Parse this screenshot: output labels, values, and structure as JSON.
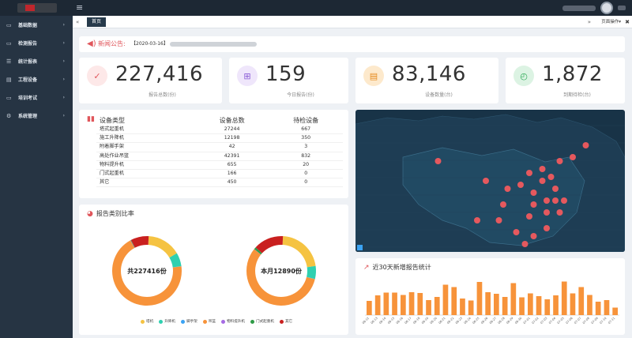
{
  "topbar": {
    "menu_icon": "hamburger-icon"
  },
  "sidebar": {
    "items": [
      {
        "label": "基础数据",
        "icon": "folder-icon"
      },
      {
        "label": "检测报告",
        "icon": "folder-icon"
      },
      {
        "label": "统计报表",
        "icon": "list-icon"
      },
      {
        "label": "工程设备",
        "icon": "server-icon"
      },
      {
        "label": "培训考试",
        "icon": "monitor-icon"
      },
      {
        "label": "系统管理",
        "icon": "gear-icon"
      }
    ]
  },
  "tabs": {
    "home": "首页",
    "page_ops": "页面操作",
    "prev_glyph": "«",
    "next_glyph": "»",
    "close_glyph": "✖"
  },
  "notice": {
    "label": "新闻公告:",
    "date_text": "【2020-03-16】"
  },
  "stats": [
    {
      "value": "227,416",
      "label": "报告总数(份)",
      "color": "#e0565b",
      "bg": "#fde8e8",
      "icon": "clipboard-icon",
      "glyph": "✓"
    },
    {
      "value": "159",
      "label": "今日报告(份)",
      "color": "#8a5cd6",
      "bg": "#efe6fb",
      "icon": "add-report-icon",
      "glyph": "⊞"
    },
    {
      "value": "83,146",
      "label": "设备数量(台)",
      "color": "#e58a1f",
      "bg": "#fde9cc",
      "icon": "barrier-icon",
      "glyph": "▤"
    },
    {
      "value": "1,872",
      "label": "到期待检(台)",
      "color": "#2eaa57",
      "bg": "#dcf3e3",
      "icon": "timer-icon",
      "glyph": "◴"
    }
  ],
  "device_panel": {
    "title": "设备类型",
    "col_total": "设备总数",
    "col_pending": "待检设备",
    "rows": [
      {
        "type": "塔式起重机",
        "total": "27244",
        "pending": "667"
      },
      {
        "type": "施工升降机",
        "total": "12198",
        "pending": "350"
      },
      {
        "type": "附着脚手架",
        "total": "42",
        "pending": "3"
      },
      {
        "type": "高处作业吊篮",
        "total": "42391",
        "pending": "832"
      },
      {
        "type": "物料提升机",
        "total": "655",
        "pending": "20"
      },
      {
        "type": "门式起重机",
        "total": "166",
        "pending": "0"
      },
      {
        "type": "其它",
        "total": "450",
        "pending": "0"
      }
    ]
  },
  "ratio_panel": {
    "title": "报告类别比率",
    "donut_left_label": "共227416份",
    "donut_right_label": "本月12890份",
    "legend": [
      {
        "name": "塔机",
        "color": "#f5c342"
      },
      {
        "name": "升降机",
        "color": "#2fd0b0"
      },
      {
        "name": "脚手架",
        "color": "#3ba3f3"
      },
      {
        "name": "吊篮",
        "color": "#f7933a"
      },
      {
        "name": "物料提升机",
        "color": "#a66be3"
      },
      {
        "name": "门式起重机",
        "color": "#2f9b47"
      },
      {
        "name": "其它",
        "color": "#c9201f"
      }
    ],
    "donut_left": [
      0.15,
      0.06,
      0.001,
      0.66,
      0.001,
      0.002,
      0.08
    ],
    "donut_right": [
      0.22,
      0.06,
      0.001,
      0.57,
      0.001,
      0.01,
      0.14
    ]
  },
  "trend_panel": {
    "title": "近30天新增报告统计",
    "bar_color": "#f7933a"
  },
  "chart_data": {
    "type": "bar",
    "categories": [
      "06-12",
      "06-13",
      "06-14",
      "06-15",
      "06-16",
      "06-17",
      "06-18",
      "06-19",
      "06-20",
      "06-21",
      "06-22",
      "06-23",
      "06-24",
      "06-25",
      "06-26",
      "06-27",
      "06-28",
      "06-29",
      "06-30",
      "07-01",
      "07-02",
      "07-03",
      "07-04",
      "07-05",
      "07-06",
      "07-07",
      "07-08",
      "07-09",
      "07-10",
      "07-11"
    ],
    "values": [
      36,
      50,
      57,
      57,
      51,
      58,
      56,
      38,
      46,
      77,
      71,
      42,
      37,
      84,
      58,
      54,
      46,
      81,
      45,
      55,
      48,
      40,
      50,
      85,
      55,
      71,
      51,
      34,
      38,
      19
    ],
    "ylim": [
      0,
      100
    ]
  },
  "map_points": [
    {
      "lon": 92,
      "lat": 41
    },
    {
      "lon": 103,
      "lat": 36
    },
    {
      "lon": 101,
      "lat": 26
    },
    {
      "lon": 107,
      "lat": 30
    },
    {
      "lon": 110,
      "lat": 23
    },
    {
      "lon": 111,
      "lat": 35
    },
    {
      "lon": 113,
      "lat": 38
    },
    {
      "lon": 114,
      "lat": 33
    },
    {
      "lon": 114,
      "lat": 30
    },
    {
      "lon": 113,
      "lat": 27
    },
    {
      "lon": 114,
      "lat": 22
    },
    {
      "lon": 116,
      "lat": 39
    },
    {
      "lon": 116,
      "lat": 36
    },
    {
      "lon": 117,
      "lat": 31
    },
    {
      "lon": 117,
      "lat": 28
    },
    {
      "lon": 117,
      "lat": 24
    },
    {
      "lon": 118,
      "lat": 37
    },
    {
      "lon": 119,
      "lat": 34
    },
    {
      "lon": 119,
      "lat": 31
    },
    {
      "lon": 120,
      "lat": 28
    },
    {
      "lon": 121,
      "lat": 31
    },
    {
      "lon": 120,
      "lat": 41
    },
    {
      "lon": 123,
      "lat": 42
    },
    {
      "lon": 126,
      "lat": 45
    },
    {
      "lon": 108,
      "lat": 34
    },
    {
      "lon": 106,
      "lat": 26
    },
    {
      "lon": 112,
      "lat": 20
    }
  ]
}
